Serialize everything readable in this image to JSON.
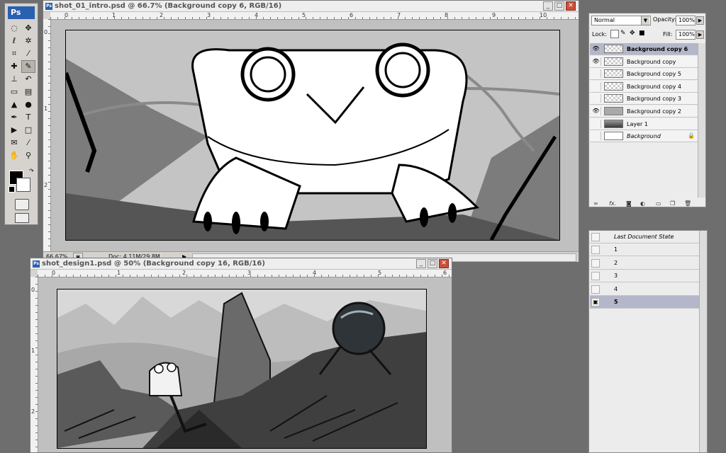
{
  "app": {
    "logo": "Ps"
  },
  "tools": [
    {
      "icon": "marquee-icon",
      "glyph": "◌"
    },
    {
      "icon": "move-icon",
      "glyph": "✥"
    },
    {
      "icon": "lasso-icon",
      "glyph": "ℓ"
    },
    {
      "icon": "magic-wand-icon",
      "glyph": "✲"
    },
    {
      "icon": "crop-icon",
      "glyph": "⌗"
    },
    {
      "icon": "slice-icon",
      "glyph": "⁄"
    },
    {
      "icon": "healing-brush-icon",
      "glyph": "✚"
    },
    {
      "icon": "brush-icon",
      "glyph": "✎"
    },
    {
      "icon": "clone-stamp-icon",
      "glyph": "⊥"
    },
    {
      "icon": "history-brush-icon",
      "glyph": "↶"
    },
    {
      "icon": "eraser-icon",
      "glyph": "▭"
    },
    {
      "icon": "gradient-icon",
      "glyph": "▤"
    },
    {
      "icon": "blur-icon",
      "glyph": "▲"
    },
    {
      "icon": "dodge-icon",
      "glyph": "●"
    },
    {
      "icon": "pen-icon",
      "glyph": "✒"
    },
    {
      "icon": "type-icon",
      "glyph": "T"
    },
    {
      "icon": "path-select-icon",
      "glyph": "▶"
    },
    {
      "icon": "shape-icon",
      "glyph": "□"
    },
    {
      "icon": "notes-icon",
      "glyph": "✉"
    },
    {
      "icon": "eyedropper-icon",
      "glyph": "⁄"
    },
    {
      "icon": "hand-icon",
      "glyph": "✋"
    },
    {
      "icon": "zoom-icon",
      "glyph": "⚲"
    }
  ],
  "colors": {
    "foreground": "#000000",
    "background": "#ffffff",
    "selected_layer": "#b3b7c9",
    "app_bg": "#6e6e6e"
  },
  "doc1": {
    "title": "shot_01_intro.psd @ 66.7% (Background copy 6, RGB/16)",
    "ruler_h": [
      "0",
      "1",
      "2",
      "3",
      "4",
      "5",
      "6",
      "7",
      "8",
      "9",
      "10"
    ],
    "ruler_v": [
      "0",
      "1",
      "2"
    ],
    "zoom": "66.67%",
    "doc_info": "Doc: 4.11M/29.8M"
  },
  "doc2": {
    "title": "shot_design1.psd @ 50% (Background copy 16, RGB/16)",
    "ruler_h": [
      "0",
      "1",
      "2",
      "3",
      "4",
      "5",
      "6"
    ],
    "ruler_v": [
      "0",
      "1",
      "2"
    ]
  },
  "layers_panel": {
    "blend_mode": "Normal",
    "opacity_label": "Opacity:",
    "opacity": "100%",
    "lock_label": "Lock:",
    "fill_label": "Fill:",
    "fill": "100%",
    "layers": [
      {
        "name": "Background copy 6",
        "visible": true,
        "selected": true,
        "thumb": "checker"
      },
      {
        "name": "Background copy",
        "visible": true,
        "selected": false,
        "thumb": "checker"
      },
      {
        "name": "Background copy 5",
        "visible": false,
        "selected": false,
        "thumb": "checker"
      },
      {
        "name": "Background copy 4",
        "visible": false,
        "selected": false,
        "thumb": "checker"
      },
      {
        "name": "Background copy 3",
        "visible": false,
        "selected": false,
        "thumb": "checker"
      },
      {
        "name": "Background copy 2",
        "visible": true,
        "selected": false,
        "thumb": "gray"
      },
      {
        "name": "Layer 1",
        "visible": false,
        "selected": false,
        "thumb": "image"
      },
      {
        "name": "Background",
        "visible": false,
        "selected": false,
        "thumb": "white",
        "locked": true
      }
    ]
  },
  "history_panel": {
    "items": [
      {
        "name": "Last Document State",
        "selected": false
      },
      {
        "name": "1",
        "selected": false
      },
      {
        "name": "2",
        "selected": false
      },
      {
        "name": "3",
        "selected": false
      },
      {
        "name": "4",
        "selected": false
      },
      {
        "name": "5",
        "selected": true
      }
    ]
  }
}
